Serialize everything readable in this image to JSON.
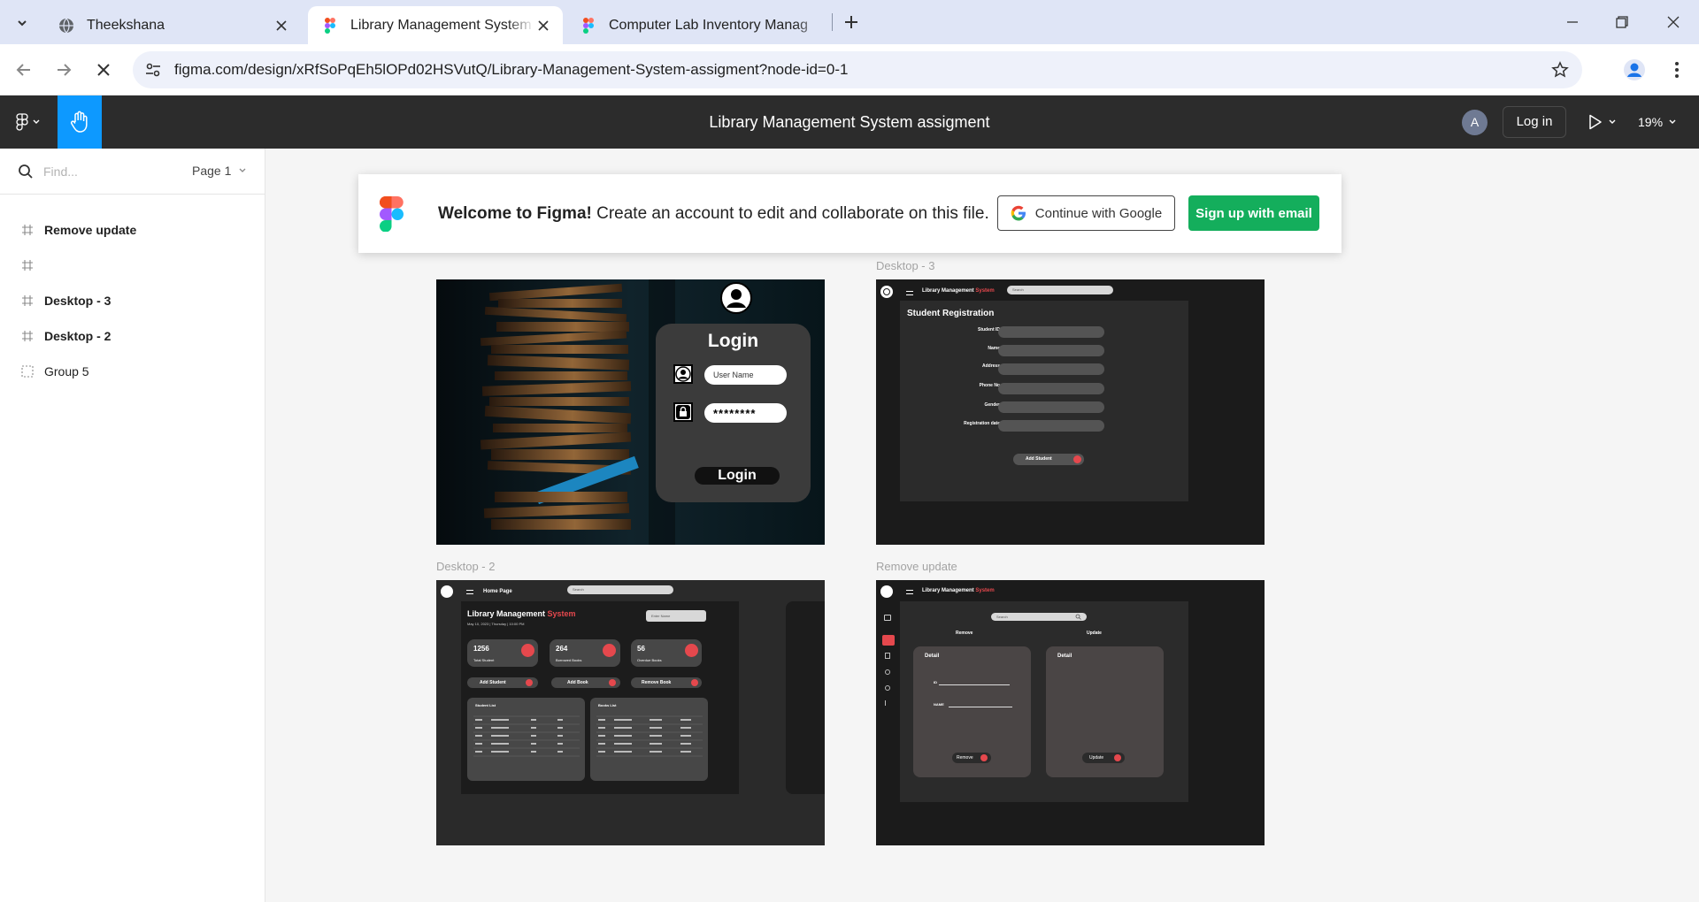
{
  "browser": {
    "tabs": [
      {
        "title": "Theekshana",
        "icon": "globe-icon",
        "active": false
      },
      {
        "title": "Library Management System as",
        "icon": "figma-icon",
        "active": true
      },
      {
        "title": "Computer Lab Inventory Manag",
        "icon": "figma-icon",
        "active": false
      }
    ],
    "url": "figma.com/design/xRfSoPqEh5lOPd02HSVutQ/Library-Management-System-assigment?node-id=0-1"
  },
  "toolbar": {
    "file_title": "Library Management System assigment",
    "avatar_initial": "A",
    "login_label": "Log in",
    "zoom": "19%"
  },
  "left_panel": {
    "search_placeholder": "Find...",
    "page_label": "Page 1",
    "layers": [
      {
        "name": "Remove update",
        "icon": "frame-icon"
      },
      {
        "name": "",
        "icon": "frame-icon"
      },
      {
        "name": "Desktop - 3",
        "icon": "frame-icon"
      },
      {
        "name": "Desktop - 2",
        "icon": "frame-icon"
      },
      {
        "name": "Group 5",
        "icon": "group-icon"
      }
    ]
  },
  "banner": {
    "welcome_bold": "Welcome to Figma!",
    "welcome_text": " Create an account to edit and collaborate on this file.",
    "google_label": "Continue with Google",
    "email_label": "Sign up with email"
  },
  "frames": {
    "login": {
      "title": "Login",
      "username_placeholder": "User Name",
      "password_value": "********",
      "button": "Login"
    },
    "desktop3": {
      "label": "Desktop - 3",
      "app_title": "Library Management ",
      "app_title_accent": "System",
      "search": "Search",
      "heading": "Student Registration",
      "fields": [
        "Student ID",
        "Name",
        "Address",
        "Phone No",
        "Gender",
        "Registration date"
      ],
      "button": "Add Student"
    },
    "desktop2": {
      "label": "Desktop - 2",
      "nav": "Home Page",
      "search": "Search",
      "title": "Library Management ",
      "title_accent": "System",
      "date": "May 10, 2023 | Thursday | 10:00 PM",
      "search_box": "Enter Name",
      "stats": [
        {
          "value": "1256",
          "label": "Total Student"
        },
        {
          "value": "264",
          "label": "Borrowed Books"
        },
        {
          "value": "56",
          "label": "Overdue Books"
        }
      ],
      "actions": [
        "Add Student",
        "Add Book",
        "Remove Book"
      ],
      "lists": [
        "Student List",
        "Books List"
      ]
    },
    "remove": {
      "label": "Remove update",
      "app_title": "Library Management ",
      "app_title_accent": "System",
      "search": "Search",
      "col_remove": "Remove",
      "col_update": "Update",
      "card_title": "Detail",
      "id_label": "ID",
      "name_label": "NAME",
      "remove_button": "Remove",
      "update_button": "Update"
    }
  },
  "colors": {
    "accent_blue": "#0d99ff",
    "accent_red": "#e5484d",
    "signup_green": "#14ae5c"
  }
}
